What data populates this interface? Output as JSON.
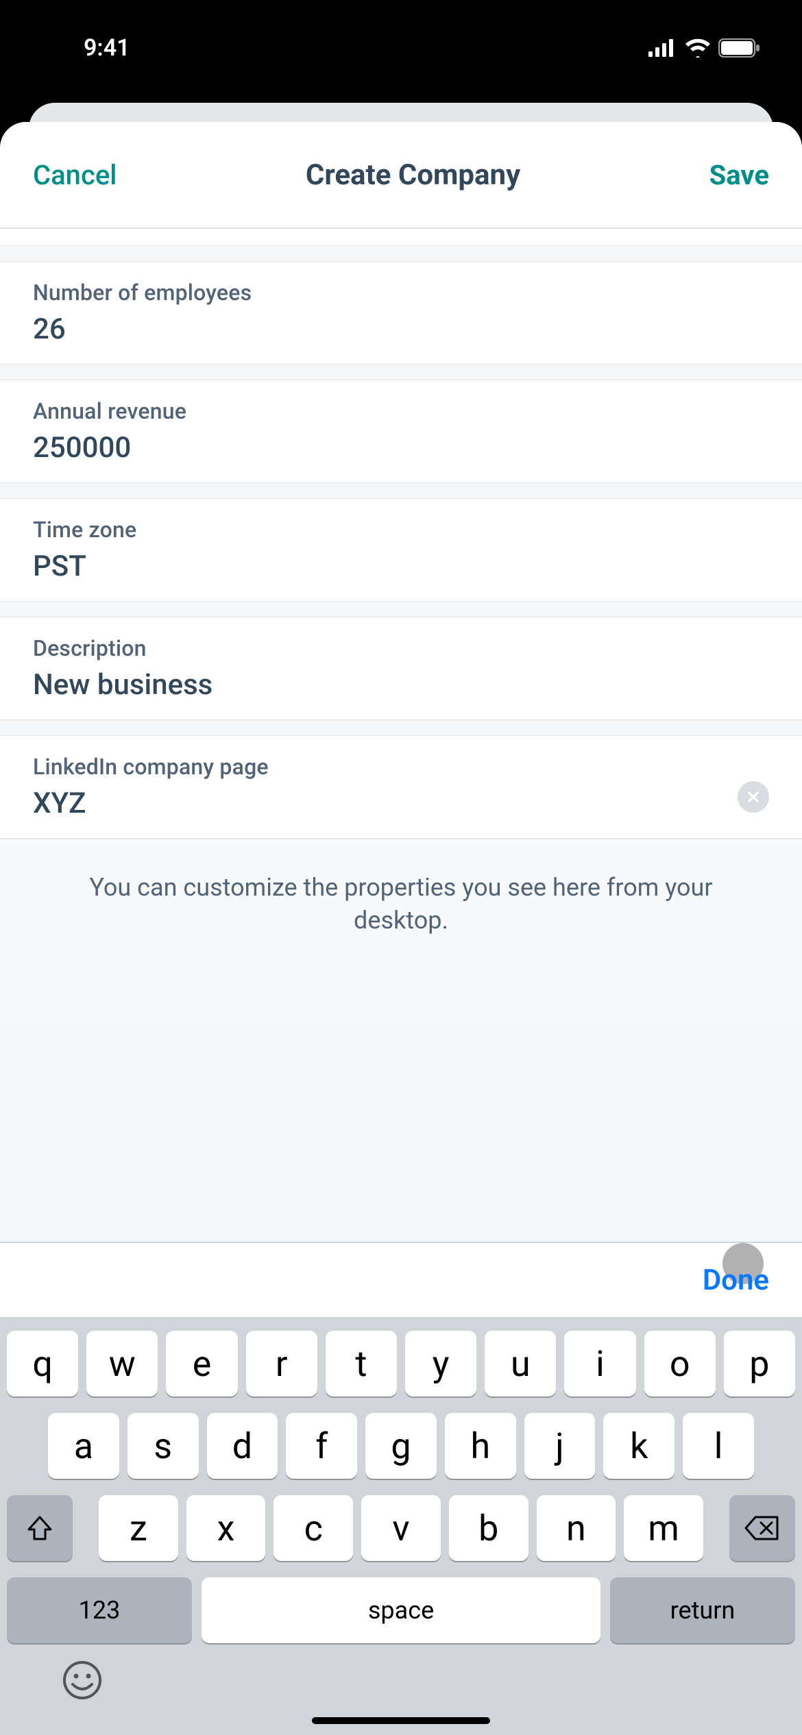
{
  "status": {
    "time": "9:41"
  },
  "header": {
    "cancel": "Cancel",
    "title": "Create Company",
    "save": "Save"
  },
  "fields": {
    "employees": {
      "label": "Number of employees",
      "value": "26"
    },
    "revenue": {
      "label": "Annual revenue",
      "value": "250000"
    },
    "timezone": {
      "label": "Time zone",
      "value": "PST"
    },
    "description": {
      "label": "Description",
      "value": "New business"
    },
    "linkedin": {
      "label": "LinkedIn company page",
      "value": "XYZ"
    }
  },
  "infoText": "You can customize the properties you see here from your desktop.",
  "accessory": {
    "done": "Done"
  },
  "keys": {
    "row1": {
      "q": "q",
      "w": "w",
      "e": "e",
      "r": "r",
      "t": "t",
      "y": "y",
      "u": "u",
      "i": "i",
      "o": "o",
      "p": "p"
    },
    "row2": {
      "a": "a",
      "s": "s",
      "d": "d",
      "f": "f",
      "g": "g",
      "h": "h",
      "j": "j",
      "k": "k",
      "l": "l"
    },
    "row3": {
      "z": "z",
      "x": "x",
      "c": "c",
      "v": "v",
      "b": "b",
      "n": "n",
      "m": "m"
    },
    "num": "123",
    "space": "space",
    "return": "return"
  }
}
